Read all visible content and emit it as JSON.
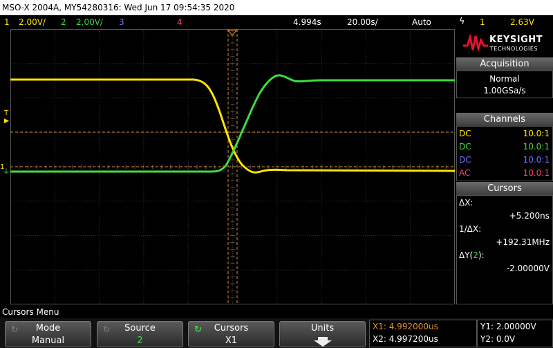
{
  "title_bar": {
    "text": "MSO-X 2004A, MY54280316: Wed Jun 17 09:54:35 2020"
  },
  "channel_bar": {
    "ch1": {
      "num": "1",
      "scale": "2.00V/"
    },
    "ch2": {
      "num": "2",
      "scale": "2.00V/"
    },
    "ch3": {
      "num": "3"
    },
    "ch4": {
      "num": "4"
    },
    "time_ref": "4.994s",
    "time_scale": "20.00s/",
    "trigger_mode": "Auto",
    "trigger_source": "1",
    "trigger_level": "2.63V"
  },
  "colors": {
    "ch1": "#ffe600",
    "ch2": "#3fdc3f",
    "ch3": "#6d74ff",
    "ch4": "#ff3f6d",
    "cursor": "#e8912a",
    "grid": "#2f2f2f"
  },
  "brand": {
    "name": "KEYSIGHT",
    "sub": "TECHNOLOGIES"
  },
  "acquisition": {
    "header": "Acquisition",
    "mode": "Normal",
    "rate": "1.00GSa/s"
  },
  "channels": {
    "header": "Channels",
    "rows": [
      {
        "coupling": "DC",
        "probe": "10.0:1"
      },
      {
        "coupling": "DC",
        "probe": "10.0:1"
      },
      {
        "coupling": "DC",
        "probe": "10.0:1"
      },
      {
        "coupling": "AC",
        "probe": "10.0:1"
      }
    ]
  },
  "cursors": {
    "header": "Cursors",
    "dx_label": "ΔX:",
    "dx_value": "+5.200ns",
    "inv_dx_label": "1/ΔX:",
    "inv_dx_value": "+192.31MHz",
    "dy_label_pre": "ΔY(",
    "dy_label_ch": "2",
    "dy_label_post": "):",
    "dy_value": "-2.00000V"
  },
  "menu": {
    "title": "Cursors Menu"
  },
  "softkeys": [
    {
      "label": "Mode",
      "value": "Manual"
    },
    {
      "label": "Source",
      "value": "2"
    },
    {
      "label": "Cursors",
      "value": "X1"
    },
    {
      "label": "Units",
      "value": ""
    }
  ],
  "readout": {
    "x1": "X1: 4.992000us",
    "x2": "X2: 4.997200us",
    "y1": "Y1: 2.00000V",
    "y2": "Y2: 0.0V"
  },
  "markers": {
    "trigger_T": "T",
    "ch1_marker": "1",
    "ch2_marker": "2"
  }
}
